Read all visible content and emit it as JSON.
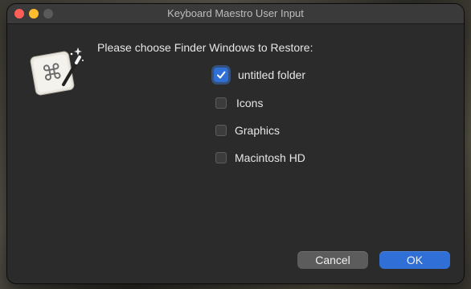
{
  "window": {
    "title": "Keyboard Maestro User Input"
  },
  "app_icon": {
    "name": "keyboard-maestro-icon",
    "glyph": "⌘"
  },
  "prompt": "Please choose Finder Windows to Restore:",
  "options": [
    {
      "label": "untitled folder",
      "checked": true
    },
    {
      "label": "Icons",
      "checked": false
    },
    {
      "label": "Graphics",
      "checked": false
    },
    {
      "label": "Macintosh HD",
      "checked": false
    }
  ],
  "buttons": {
    "cancel": "Cancel",
    "ok": "OK"
  },
  "colors": {
    "accent": "#2f6fd6",
    "window_bg": "#2b2b2b",
    "close": "#ff5f57",
    "minimize": "#febc2e"
  }
}
